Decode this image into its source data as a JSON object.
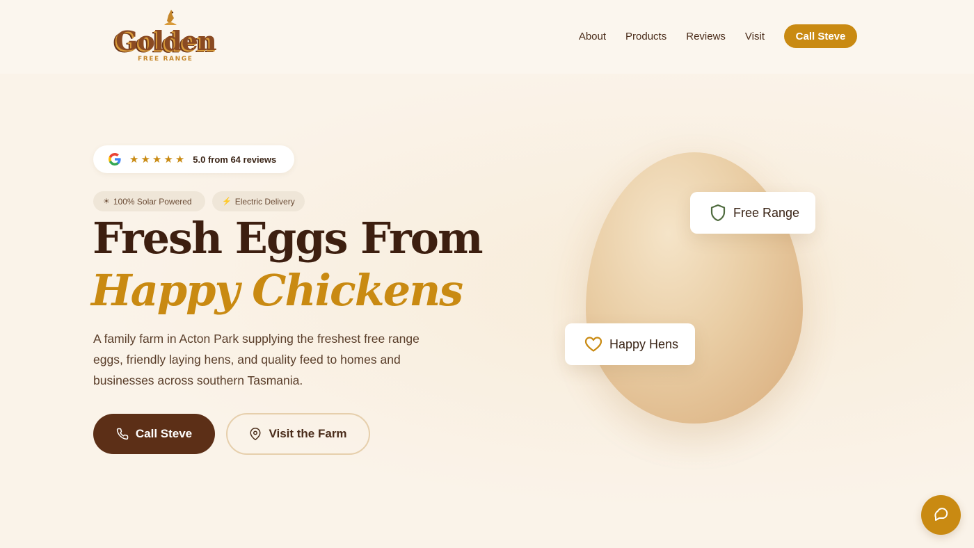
{
  "brand": {
    "logo_text": "Golden",
    "logo_subtext": "FREE RANGE"
  },
  "nav": {
    "links": [
      "About",
      "Products",
      "Reviews",
      "Visit"
    ],
    "cta_label": "Call Steve"
  },
  "hero": {
    "rating_text": "5.0 from 64 reviews",
    "star_count": 5,
    "tags": [
      {
        "icon": "sun-icon",
        "label": "100% Solar Powered"
      },
      {
        "icon": "lightning-icon",
        "label": "Electric Delivery"
      }
    ],
    "title_line1": "Fresh Eggs From",
    "title_line2": "Happy Chickens",
    "lead": "A family farm in Acton Park supplying the freshest free range eggs, friendly laying hens, and quality feed to homes and businesses across southern Tasmania.",
    "primary_button": "Call Steve",
    "secondary_button": "Visit the Farm",
    "badges": {
      "free_range": "Free Range",
      "happy_hens": "Happy Hens"
    }
  },
  "colors": {
    "accent": "#c98a12",
    "dark_brown": "#5c2f17",
    "background": "#faf3e9"
  }
}
